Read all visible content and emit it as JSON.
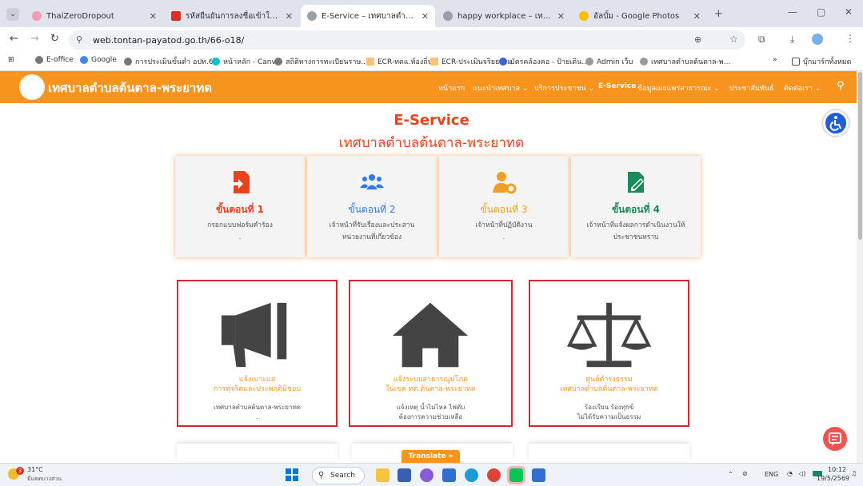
{
  "browser": {
    "tabs": [
      {
        "title": "ThaiZeroDropout",
        "color": "#f29bb2"
      },
      {
        "title": "รหัสยืนยันการลงชื่อเข้าใช้ระบบ Thai",
        "color": "#d93025"
      },
      {
        "title": "E-Service – เทศบาลตำบลต้นตาล-พระยาทด",
        "color": "#9aa0a6"
      },
      {
        "title": "happy workplace – เทศบาลตำบลต้น",
        "color": "#9aa0a6"
      },
      {
        "title": "อัลบั้ม - Google Photos",
        "color": "#fbbc04"
      }
    ],
    "url": "web.tontan-payatod.go.th/66-o18/",
    "bookmarks": [
      "E-office",
      "Google",
      "การประเมินขั้นต่ำ อปท.68",
      "หน้าหลัก - Canva",
      "สถิติทางการทะเบียนราษ...",
      "ECR-ทดแ.ท้องถิ่น",
      "ECR-ประเมินจริยธรรม",
      "บัตรคล้องคอ - ป้ายเดิน...",
      "Admin เว็บ",
      "เทศบาลตำบลต้นตาล-พ..."
    ],
    "bookmarks_folder": "บุ๊กมาร์กทั้งหมด"
  },
  "site": {
    "name": "เทศบาลตำบลต้นตาล-พระยาทด",
    "nav": [
      "หน้าแรก",
      "แนะนำเทศบาล ⌄",
      "บริการประชาชน ⌄",
      "E-Service",
      "ข้อมูลเผยแพร่สาธารณะ ⌄",
      "ประชาสัมพันธ์",
      "ติดต่อเรา ⌄"
    ],
    "page_title": "E-Service",
    "page_subtitle": "เทศบาลตำบลต้นตาล-พระยาทด",
    "steps": [
      {
        "heading": "ขั้นตอนที่ 1",
        "desc": "กรอกแบบฟอร์มคำร้อง",
        "desc2": "."
      },
      {
        "heading": "ขั้นตอนที่ 2",
        "desc": "เจ้าหน้าที่รับเรื่องและประสาน",
        "desc2": "หน่วยงานที่เกี่ยวข้อง"
      },
      {
        "heading": "ขั้นตอนที่ 3",
        "desc": "เจ้าหน้าที่ปฏิบัติงาน",
        "desc2": "."
      },
      {
        "heading": "ขั้นตอนที่ 4",
        "desc": "เจ้าหน้าที่แจ้งผลการดำเนินงานให้",
        "desc2": "ประชาชนทราบ"
      }
    ],
    "cards": [
      {
        "title1": "แจ้งเบาะแส",
        "title2": "การทุจริตและประพฤติมิชอบ",
        "desc1": "เทศบาลตำบลต้นตาล-พระยาทด",
        "desc2": "."
      },
      {
        "title1": "แจ้งระบบสาธารณูปโภค",
        "title2": "ในเขต ทต.ต้นตาล-พระยาทด",
        "desc1": "แจ้งเหตุ น้ำไม่ไหล ไฟดับ",
        "desc2": "ต้องการความช่วยเหลือ"
      },
      {
        "title1": "ศูนย์ดำรงธรรม",
        "title2": "เทศบาลตำบลต้นตาล-พระยาทด",
        "desc1": "ร้องเรียน ร้องทุกข์",
        "desc2": "ไม่ได้รับความเป็นธรรม"
      }
    ],
    "translate_label": "Translate »"
  },
  "taskbar": {
    "weather_temp": "31°C",
    "weather_desc": "มีแดดบางส่วน",
    "notify_count": "3",
    "search_label": "Search",
    "lang": "ENG",
    "time": "10:12",
    "date": "19/5/2569"
  }
}
